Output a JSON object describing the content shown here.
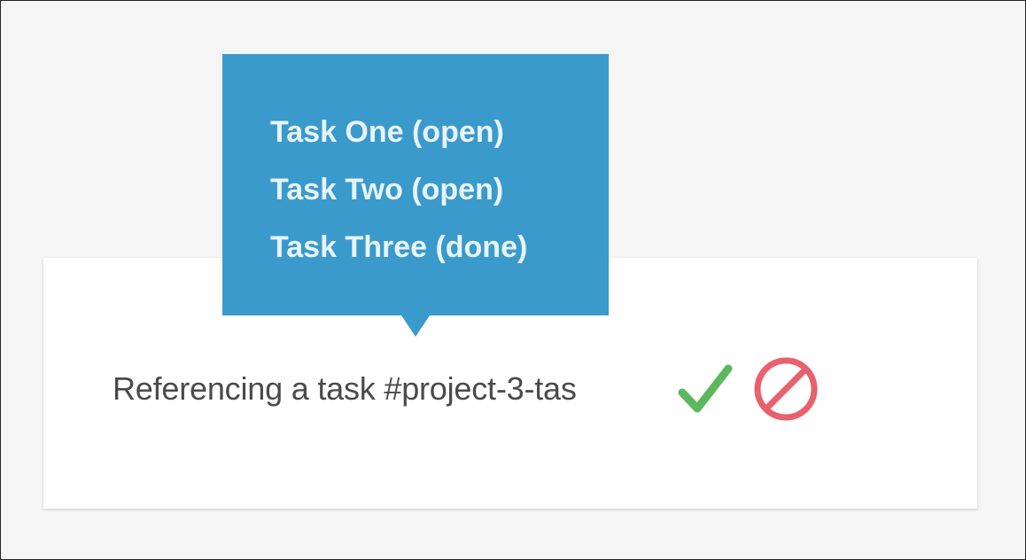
{
  "editor": {
    "input_value": "Referencing a task #project-3-tas"
  },
  "actions": {
    "confirm_icon": "checkmark-icon",
    "confirm_color": "#5cb85c",
    "cancel_icon": "block-icon",
    "cancel_color": "#e8616d"
  },
  "popup": {
    "background": "#3a9acb",
    "suggestions": [
      {
        "label": "Task One (open)"
      },
      {
        "label": "Task Two (open)"
      },
      {
        "label": "Task Three (done)"
      }
    ]
  }
}
